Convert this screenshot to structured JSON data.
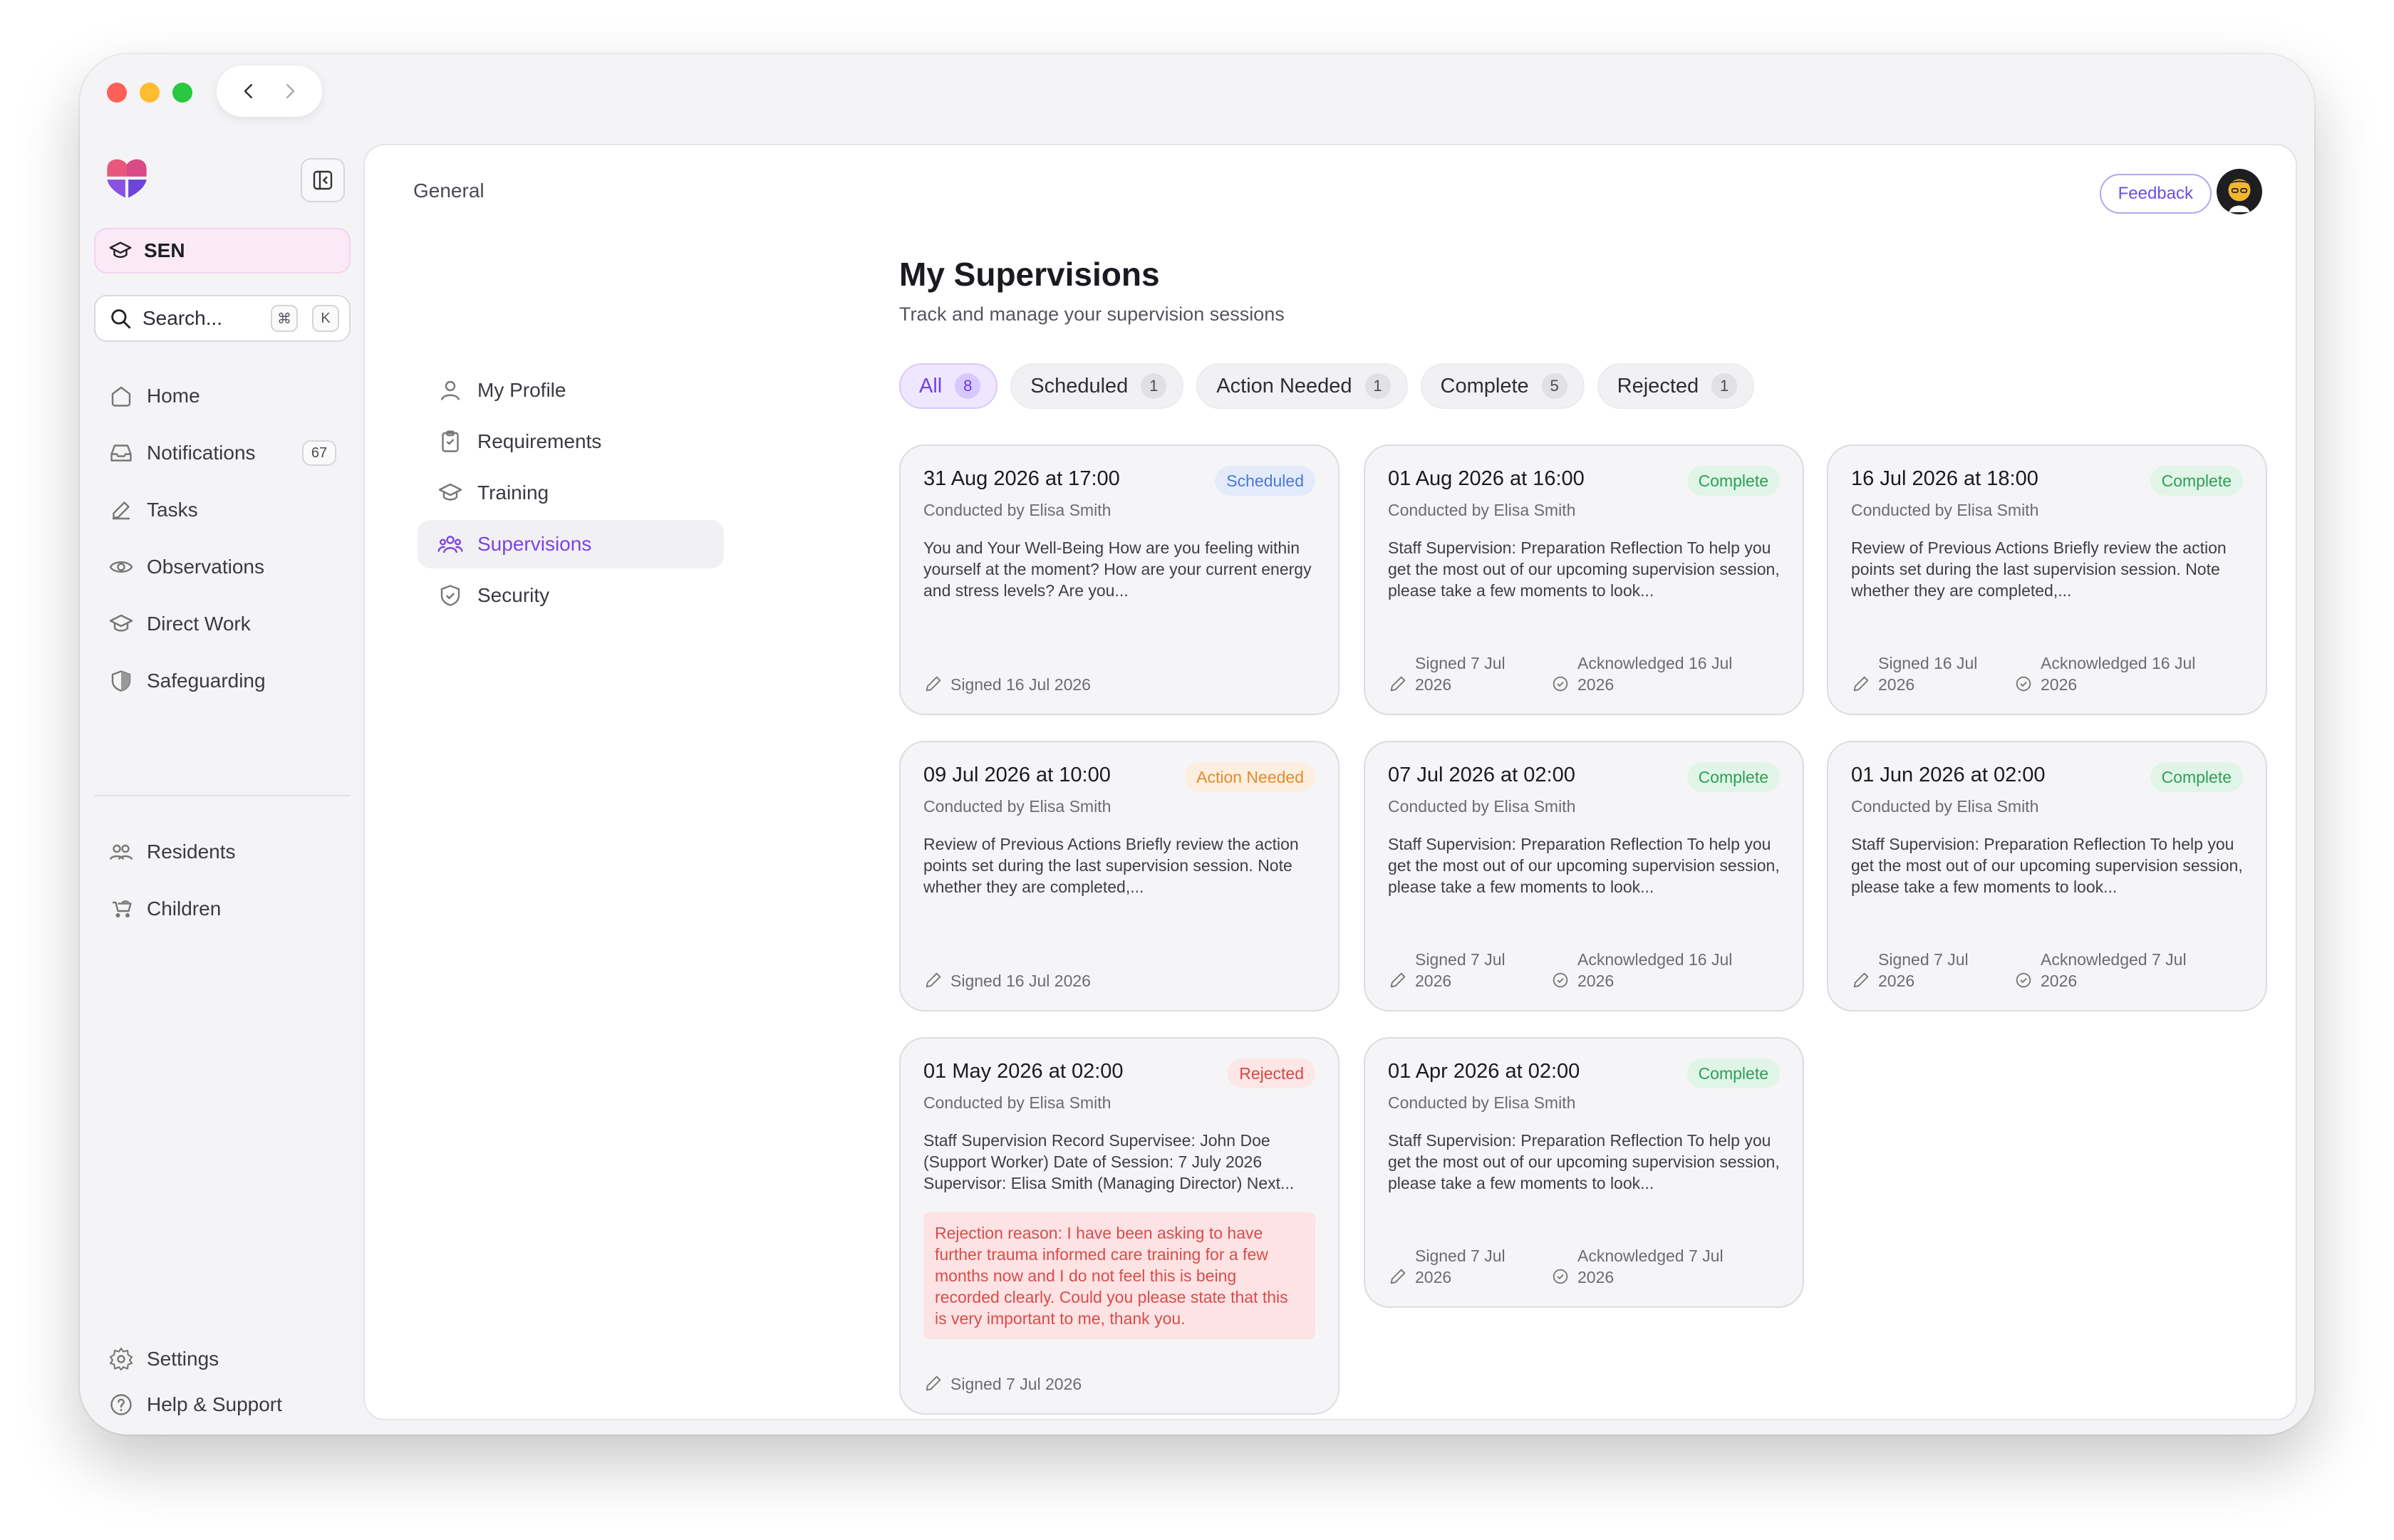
{
  "sidebar": {
    "org": "SEN",
    "search": {
      "placeholder": "Search...",
      "shortcut_keys": [
        "⌘",
        "K"
      ]
    },
    "nav": [
      {
        "label": "Home",
        "icon": "home-icon"
      },
      {
        "label": "Notifications",
        "icon": "inbox-icon",
        "count": "67"
      },
      {
        "label": "Tasks",
        "icon": "edit-icon"
      },
      {
        "label": "Observations",
        "icon": "eye-icon"
      },
      {
        "label": "Direct Work",
        "icon": "graduation-cap-icon"
      },
      {
        "label": "Safeguarding",
        "icon": "shield-icon"
      }
    ],
    "nav2": [
      {
        "label": "Residents",
        "icon": "users-icon"
      },
      {
        "label": "Children",
        "icon": "stroller-icon"
      }
    ],
    "nav3": [
      {
        "label": "Settings",
        "icon": "gear-icon"
      },
      {
        "label": "Help & Support",
        "icon": "help-icon"
      }
    ]
  },
  "header": {
    "breadcrumb": "General",
    "feedback": "Feedback"
  },
  "subnav": [
    {
      "label": "My Profile",
      "icon": "user-icon"
    },
    {
      "label": "Requirements",
      "icon": "clipboard-icon"
    },
    {
      "label": "Training",
      "icon": "graduation-cap-icon"
    },
    {
      "label": "Supervisions",
      "icon": "team-icon",
      "active": true
    },
    {
      "label": "Security",
      "icon": "shield-check-icon"
    }
  ],
  "page": {
    "title": "My Supervisions",
    "subtitle": "Track and manage your supervision sessions"
  },
  "tabs": [
    {
      "label": "All",
      "count": "8",
      "active": true
    },
    {
      "label": "Scheduled",
      "count": "1"
    },
    {
      "label": "Action Needed",
      "count": "1"
    },
    {
      "label": "Complete",
      "count": "5"
    },
    {
      "label": "Rejected",
      "count": "1"
    }
  ],
  "cards": [
    {
      "date": "31 Aug 2026 at 17:00",
      "by": "Conducted by Elisa Smith",
      "status": "Scheduled",
      "body": "You and Your Well-Being How are you feeling within yourself at the moment? How are your current energy and stress levels? Are you...",
      "signed": "Signed 16 Jul 2026"
    },
    {
      "date": "01 Aug 2026 at 16:00",
      "by": "Conducted by Elisa Smith",
      "status": "Complete",
      "body": "Staff Supervision: Preparation Reflection To help you get the most out of our upcoming supervision session, please take a few moments to look...",
      "signed": "Signed 7 Jul 2026",
      "acknowledged": "Acknowledged 16 Jul 2026"
    },
    {
      "date": "16 Jul 2026 at 18:00",
      "by": "Conducted by Elisa Smith",
      "status": "Complete",
      "body": "Review of Previous Actions Briefly review the action points set during the last supervision session. Note whether they are completed,...",
      "signed": "Signed 16 Jul 2026",
      "acknowledged": "Acknowledged 16 Jul 2026"
    },
    {
      "date": "09 Jul 2026 at 10:00",
      "by": "Conducted by Elisa Smith",
      "status": "Action Needed",
      "body": "Review of Previous Actions Briefly review the action points set during the last supervision session. Note whether they are completed,...",
      "signed": "Signed 16 Jul 2026"
    },
    {
      "date": "07 Jul 2026 at 02:00",
      "by": "Conducted by Elisa Smith",
      "status": "Complete",
      "body": "Staff Supervision: Preparation Reflection To help you get the most out of our upcoming supervision session, please take a few moments to look...",
      "signed": "Signed 7 Jul 2026",
      "acknowledged": "Acknowledged 16 Jul 2026"
    },
    {
      "date": "01 Jun 2026 at 02:00",
      "by": "Conducted by Elisa Smith",
      "status": "Complete",
      "body": "Staff Supervision: Preparation Reflection To help you get the most out of our upcoming supervision session, please take a few moments to look...",
      "signed": "Signed 7 Jul 2026",
      "acknowledged": "Acknowledged 7 Jul 2026"
    },
    {
      "date": "01 May 2026 at 02:00",
      "by": "Conducted by Elisa Smith",
      "status": "Rejected",
      "body": "Staff Supervision Record Supervisee: John Doe (Support Worker) Date of Session: 7 July 2026 Supervisor: Elisa Smith (Managing Director) Next...",
      "rejection": "Rejection reason: I have been asking to have further trauma informed care training for a few months now and I do not feel this is being recorded clearly. Could you please state that this is very important to me, thank you.",
      "signed": "Signed 7 Jul 2026"
    },
    {
      "date": "01 Apr 2026 at 02:00",
      "by": "Conducted by Elisa Smith",
      "status": "Complete",
      "body": "Staff Supervision: Preparation Reflection To help you get the most out of our upcoming supervision session, please take a few moments to look...",
      "signed": "Signed 7 Jul 2026",
      "acknowledged": "Acknowledged 7 Jul 2026"
    }
  ],
  "colors": {
    "accent": "#7c45e0",
    "scheduled": "#4a78d6",
    "complete": "#2f9e56",
    "action_needed": "#e48a2c",
    "rejected": "#d74848"
  }
}
